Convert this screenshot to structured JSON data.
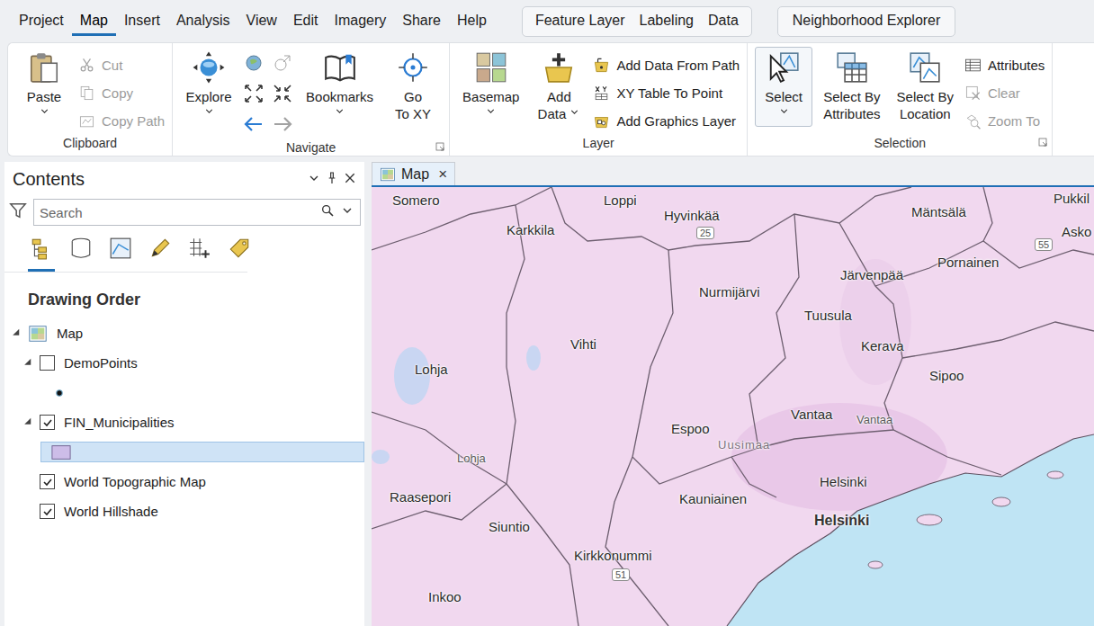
{
  "menu": {
    "tabs": [
      {
        "label": "Project",
        "selected": false
      },
      {
        "label": "Map",
        "selected": true
      },
      {
        "label": "Insert",
        "selected": false
      },
      {
        "label": "Analysis",
        "selected": false
      },
      {
        "label": "View",
        "selected": false
      },
      {
        "label": "Edit",
        "selected": false
      },
      {
        "label": "Imagery",
        "selected": false
      },
      {
        "label": "Share",
        "selected": false
      },
      {
        "label": "Help",
        "selected": false
      }
    ],
    "contextual_tabs": [
      {
        "label": "Feature Layer",
        "selected": false
      },
      {
        "label": "Labeling",
        "selected": false
      },
      {
        "label": "Data",
        "selected": false
      }
    ],
    "extra_tabs": [
      {
        "label": "Neighborhood Explorer",
        "selected": false
      }
    ]
  },
  "ribbon": {
    "groups": [
      {
        "label": "Clipboard",
        "launcher": false,
        "items": [
          {
            "kind": "large",
            "lines": [
              "Paste"
            ],
            "dropdown": true,
            "disabled": false,
            "selected": false
          },
          {
            "kind": "stack",
            "items": [
              {
                "label": "Cut",
                "disabled": true
              },
              {
                "label": "Copy",
                "disabled": true
              },
              {
                "label": "Copy Path",
                "disabled": true
              }
            ]
          }
        ]
      },
      {
        "label": "Navigate",
        "launcher": true,
        "items": [
          {
            "kind": "large",
            "lines": [
              "Explore"
            ],
            "dropdown": true,
            "disabled": false,
            "selected": false
          },
          {
            "kind": "icons",
            "items": [
              {
                "disabled": false
              },
              {
                "disabled": true
              },
              {
                "disabled": false
              },
              {
                "disabled": false
              },
              {
                "disabled": false
              },
              {
                "disabled": true
              }
            ]
          },
          {
            "kind": "large",
            "lines": [
              "Bookmarks"
            ],
            "dropdown": true,
            "disabled": false,
            "selected": false
          },
          {
            "kind": "large",
            "lines": [
              "Go",
              "To XY"
            ],
            "dropdown": false,
            "disabled": false,
            "selected": false
          }
        ]
      },
      {
        "label": "Layer",
        "launcher": false,
        "items": [
          {
            "kind": "large",
            "lines": [
              "Basemap"
            ],
            "dropdown": true,
            "disabled": false,
            "selected": false
          },
          {
            "kind": "large",
            "lines": [
              "Add",
              "Data"
            ],
            "dropdown": true,
            "disabled": false,
            "selected": false
          },
          {
            "kind": "stack",
            "items": [
              {
                "label": "Add Data From Path",
                "disabled": false
              },
              {
                "label": "XY Table To Point",
                "disabled": false
              },
              {
                "label": "Add Graphics Layer",
                "disabled": false
              }
            ]
          }
        ]
      },
      {
        "label": "Selection",
        "launcher": true,
        "items": [
          {
            "kind": "large",
            "lines": [
              "Select"
            ],
            "dropdown": true,
            "disabled": false,
            "selected": true
          },
          {
            "kind": "large",
            "lines": [
              "Select By",
              "Attributes"
            ],
            "dropdown": false,
            "disabled": false,
            "selected": false
          },
          {
            "kind": "large",
            "lines": [
              "Select By",
              "Location"
            ],
            "dropdown": false,
            "disabled": false,
            "selected": false
          },
          {
            "kind": "stack",
            "items": [
              {
                "label": "Attributes",
                "disabled": false
              },
              {
                "label": "Clear",
                "disabled": true
              },
              {
                "label": "Zoom To",
                "disabled": true
              }
            ]
          }
        ]
      }
    ]
  },
  "contents": {
    "title": "Contents",
    "search": {
      "placeholder": "Search"
    },
    "views": [
      {
        "selected": true
      },
      {
        "selected": false
      },
      {
        "selected": false
      },
      {
        "selected": false
      },
      {
        "selected": false
      },
      {
        "selected": false
      }
    ],
    "heading": "Drawing Order",
    "tree": [
      {
        "kind": "map",
        "label": "Map",
        "depth": 0,
        "expandable": true,
        "expanded": true,
        "checked": false,
        "selected": false
      },
      {
        "kind": "layer",
        "label": "DemoPoints",
        "depth": 1,
        "expandable": true,
        "expanded": true,
        "checked": false,
        "selected": false
      },
      {
        "kind": "point-symbol",
        "label": "",
        "depth": 2,
        "expandable": false,
        "expanded": false,
        "checked": false,
        "selected": false
      },
      {
        "kind": "layer",
        "label": "FIN_Municipalities",
        "depth": 1,
        "expandable": true,
        "expanded": true,
        "checked": true,
        "selected": false
      },
      {
        "kind": "polygon-symbol",
        "label": "",
        "depth": 2,
        "expandable": false,
        "expanded": false,
        "checked": false,
        "selected": true
      },
      {
        "kind": "layer",
        "label": "World Topographic Map",
        "depth": 1,
        "expandable": false,
        "expanded": false,
        "checked": true,
        "selected": false
      },
      {
        "kind": "layer",
        "label": "World Hillshade",
        "depth": 1,
        "expandable": false,
        "expanded": false,
        "checked": true,
        "selected": false
      }
    ]
  },
  "map_view": {
    "tab": {
      "label": "Map",
      "selected": true,
      "close": "×"
    },
    "labels": [
      {
        "text": "Somero",
        "kind": "place"
      },
      {
        "text": "Loppi",
        "kind": "place"
      },
      {
        "text": "Hyvinkää",
        "kind": "place"
      },
      {
        "text": "25",
        "kind": "road"
      },
      {
        "text": "Mäntsälä",
        "kind": "place"
      },
      {
        "text": "Pukkil",
        "kind": "place"
      },
      {
        "text": "Asko",
        "kind": "place"
      },
      {
        "text": "55",
        "kind": "road"
      },
      {
        "text": "Karkkila",
        "kind": "place"
      },
      {
        "text": "Nurmijärvi",
        "kind": "place"
      },
      {
        "text": "Järvenpää",
        "kind": "place"
      },
      {
        "text": "Pornainen",
        "kind": "place"
      },
      {
        "text": "Tuusula",
        "kind": "place"
      },
      {
        "text": "Vihti",
        "kind": "place"
      },
      {
        "text": "Kerava",
        "kind": "place"
      },
      {
        "text": "Lohja",
        "kind": "place"
      },
      {
        "text": "Sipoo",
        "kind": "place"
      },
      {
        "text": "Vantaa",
        "kind": "place"
      },
      {
        "text": "Vantaa",
        "kind": "small"
      },
      {
        "text": "Espoo",
        "kind": "place"
      },
      {
        "text": "Uusimaa",
        "kind": "region"
      },
      {
        "text": "Lohja",
        "kind": "small"
      },
      {
        "text": "Helsinki",
        "kind": "place"
      },
      {
        "text": "Raasepori",
        "kind": "place"
      },
      {
        "text": "Kauniainen",
        "kind": "place"
      },
      {
        "text": "Helsinki",
        "kind": "capital"
      },
      {
        "text": "Siuntio",
        "kind": "place"
      },
      {
        "text": "Kirkkonummi",
        "kind": "place"
      },
      {
        "text": "51",
        "kind": "road"
      },
      {
        "text": "Inkoo",
        "kind": "place"
      }
    ]
  }
}
